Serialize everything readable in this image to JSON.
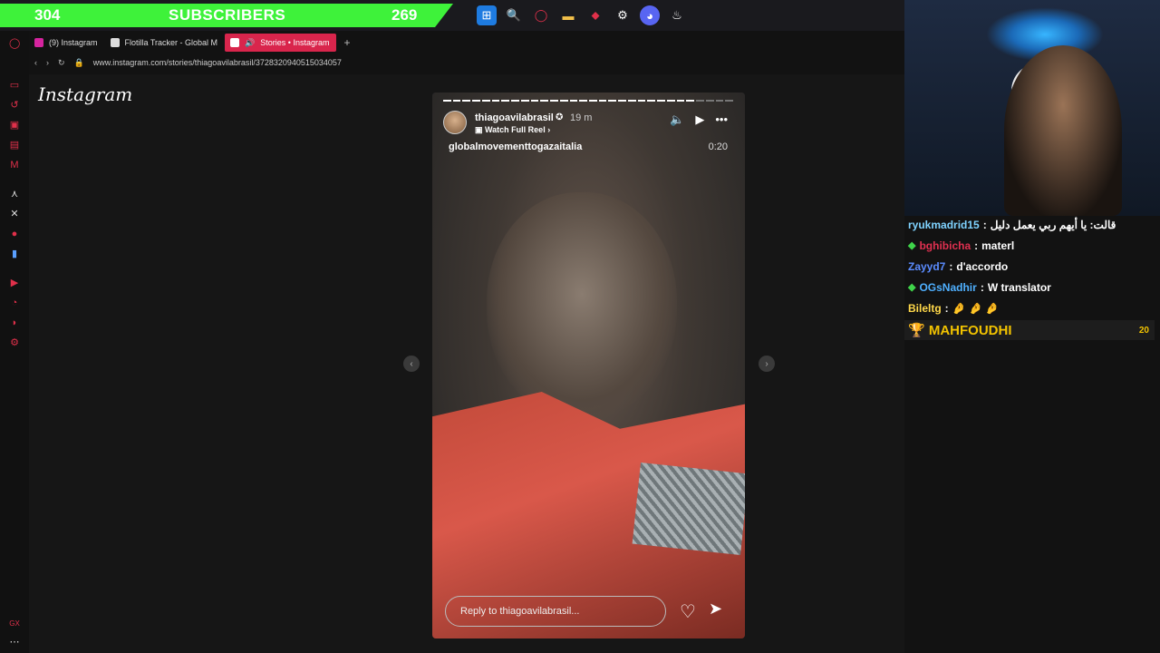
{
  "subscriber_bar": {
    "left_count": "304",
    "label": "SUBSCRIBERS",
    "right_count": "269",
    "color": "#3ef23a"
  },
  "tabs": [
    {
      "label": "(9) Instagram",
      "active": false
    },
    {
      "label": "Flotilla Tracker - Global M",
      "active": false
    },
    {
      "label": "Stories • Instagram",
      "active": true
    }
  ],
  "address": {
    "url": "www.instagram.com/stories/thiagoavilabrasil/3728320940515034057"
  },
  "page": {
    "logo": "Instagram",
    "story": {
      "username": "thiagoavilabrasil",
      "time": "19 m",
      "reel_link": "Watch Full Reel",
      "music": "globalmovementtogazaitalia",
      "duration": "0:20",
      "reply_placeholder": "Reply to thiagoavilabrasil...",
      "progress_segments": 30,
      "progress_watched": 26
    }
  },
  "chat": {
    "messages": [
      {
        "user": "ryukmadrid15",
        "text": "قالت: يا أيهم ربي يعمل دليل",
        "color": "#7fd3ff",
        "badge": false
      },
      {
        "user": "bghibicha",
        "text": "materl",
        "color": "#e03050",
        "badge": true
      },
      {
        "user": "Zayyd7",
        "text": "d'accordo",
        "color": "#5b8cff",
        "badge": false
      },
      {
        "user": "OGsNadhir",
        "text": "W translator",
        "color": "#4fb0ff",
        "badge": true
      },
      {
        "user": "Bileltg",
        "text": "🤌 🤌 🤌",
        "color": "#ffd84a",
        "badge": false
      }
    ],
    "top": {
      "name": "MAHFOUDHI",
      "count": "20"
    }
  }
}
